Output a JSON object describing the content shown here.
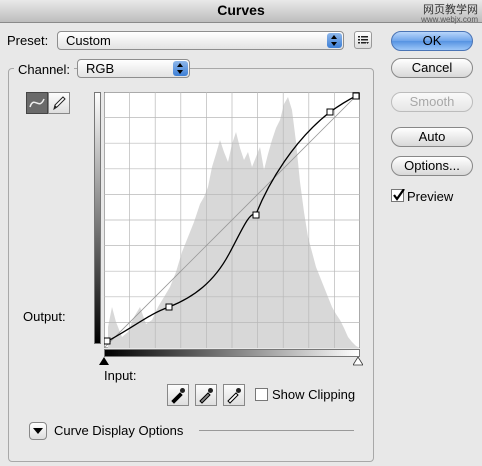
{
  "window": {
    "title": "Curves"
  },
  "watermark": {
    "line1": "网页教学网",
    "line2": "www.webjx.com"
  },
  "preset": {
    "label": "Preset:",
    "value": "Custom"
  },
  "channel": {
    "label": "Channel:",
    "value": "RGB"
  },
  "buttons": {
    "ok": "OK",
    "cancel": "Cancel",
    "smooth": "Smooth",
    "auto": "Auto",
    "options": "Options..."
  },
  "preview": {
    "label": "Preview",
    "checked": true
  },
  "graph": {
    "output_label": "Output:",
    "input_label": "Input:"
  },
  "show_clipping": {
    "label": "Show Clipping",
    "checked": false
  },
  "curve_display": {
    "label": "Curve Display Options"
  },
  "icons": [
    "curve-tool-icon",
    "pencil-tool-icon",
    "black-eyedropper-icon",
    "gray-eyedropper-icon",
    "white-eyedropper-icon",
    "preset-menu-icon",
    "disclosure-triangle-icon"
  ],
  "colors": {
    "accent": "#5693e2",
    "graph_bg": "#ffffff",
    "histogram": "#d8d8d8"
  }
}
